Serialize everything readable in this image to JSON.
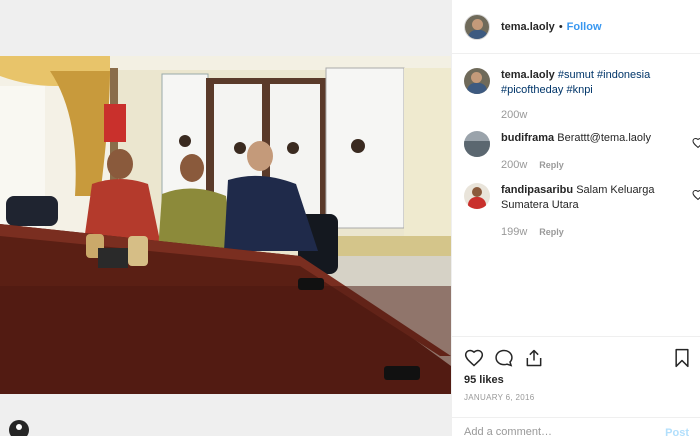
{
  "post": {
    "username": "tema.laoly",
    "separator": "•",
    "follow_label": "Follow",
    "caption": {
      "username": "tema.laoly",
      "hashtags": [
        "#sumut",
        "#indonesia",
        "#picoftheday",
        "#knpi"
      ],
      "time": "200w"
    },
    "comments": [
      {
        "username": "budiframa",
        "text": "Berattt@tema.laoly",
        "time": "200w",
        "reply_label": "Reply"
      },
      {
        "username": "fandipasaribu",
        "text": "Salam Keluarga Sumatera Utara",
        "time": "199w",
        "reply_label": "Reply"
      }
    ],
    "likes": "95 likes",
    "date": "JANUARY 6, 2016",
    "add_comment_placeholder": "Add a comment…",
    "post_label": "Post"
  },
  "icons": {
    "like": "heart-icon",
    "comment": "comment-icon",
    "share": "share-icon",
    "save": "bookmark-icon",
    "user_tag": "user-tag-icon"
  },
  "colors": {
    "link": "#3897f0",
    "hashtag": "#003569",
    "muted": "#999999"
  }
}
